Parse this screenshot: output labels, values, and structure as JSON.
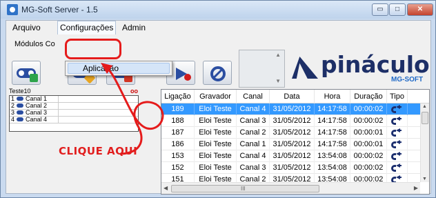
{
  "window": {
    "title": "MG-Soft Server - 1.5",
    "minimize_glyph": "▭",
    "maximize_glyph": "□",
    "close_glyph": "✕"
  },
  "menu": {
    "items": [
      {
        "label": "Arquivo"
      },
      {
        "label": "Configurações",
        "active": true
      },
      {
        "label": "Admin"
      }
    ],
    "dropdown": {
      "items": [
        {
          "label": "Aplicação",
          "highlighted": true
        }
      ]
    }
  },
  "modules": {
    "label": "Módulos Co",
    "toolbar_icons": [
      "add-recorder-icon",
      "edit-recorder-icon",
      "delete-recorder-icon",
      "play-icon",
      "stop-icon"
    ]
  },
  "spin_box": {
    "up_glyph": "▲",
    "down_glyph": "▼"
  },
  "logo": {
    "word": "pináculo",
    "sub": "MG-SOFT"
  },
  "channel_panel": {
    "title": "Teste10",
    "right_marker": "oo",
    "rows": [
      {
        "num": "1",
        "name": "Canal 1"
      },
      {
        "num": "2",
        "name": "Canal 2"
      },
      {
        "num": "3",
        "name": "Canal 3"
      },
      {
        "num": "4",
        "name": "Canal 4"
      }
    ]
  },
  "calls_table": {
    "columns": [
      "Ligação",
      "Gravador",
      "Canal",
      "Data",
      "Hora",
      "Duração",
      "Tipo"
    ],
    "rows": [
      {
        "ligacao": "189",
        "gravador": "Eloi Teste",
        "canal": "Canal 4",
        "data": "31/05/2012",
        "hora": "14:17:58",
        "duracao": "00:00:02",
        "tipo": "phone-in-icon",
        "selected": true
      },
      {
        "ligacao": "188",
        "gravador": "Eloi Teste",
        "canal": "Canal 3",
        "data": "31/05/2012",
        "hora": "14:17:58",
        "duracao": "00:00:02",
        "tipo": "phone-in-icon"
      },
      {
        "ligacao": "187",
        "gravador": "Eloi Teste",
        "canal": "Canal 2",
        "data": "31/05/2012",
        "hora": "14:17:58",
        "duracao": "00:00:01",
        "tipo": "phone-in-icon"
      },
      {
        "ligacao": "186",
        "gravador": "Eloi Teste",
        "canal": "Canal 1",
        "data": "31/05/2012",
        "hora": "14:17:58",
        "duracao": "00:00:01",
        "tipo": "phone-in-icon"
      },
      {
        "ligacao": "153",
        "gravador": "Eloi Teste",
        "canal": "Canal 4",
        "data": "31/05/2012",
        "hora": "13:54:08",
        "duracao": "00:00:02",
        "tipo": "phone-in-icon"
      },
      {
        "ligacao": "152",
        "gravador": "Eloi Teste",
        "canal": "Canal 3",
        "data": "31/05/2012",
        "hora": "13:54:08",
        "duracao": "00:00:02",
        "tipo": "phone-in-icon"
      },
      {
        "ligacao": "151",
        "gravador": "Eloi Teste",
        "canal": "Canal 2",
        "data": "31/05/2012",
        "hora": "13:54:08",
        "duracao": "00:00:02",
        "tipo": "phone-in-icon"
      }
    ],
    "hscroll_grip": "III",
    "arrows": {
      "up": "▲",
      "down": "▼",
      "left": "◀",
      "right": "▶"
    }
  },
  "annotation": {
    "text": "CLIQUE AQUI",
    "color": "#e51b1b"
  },
  "colors": {
    "selection": "#3399ff",
    "brand_navy": "#1d2f67",
    "brand_blue": "#1f69c7"
  }
}
